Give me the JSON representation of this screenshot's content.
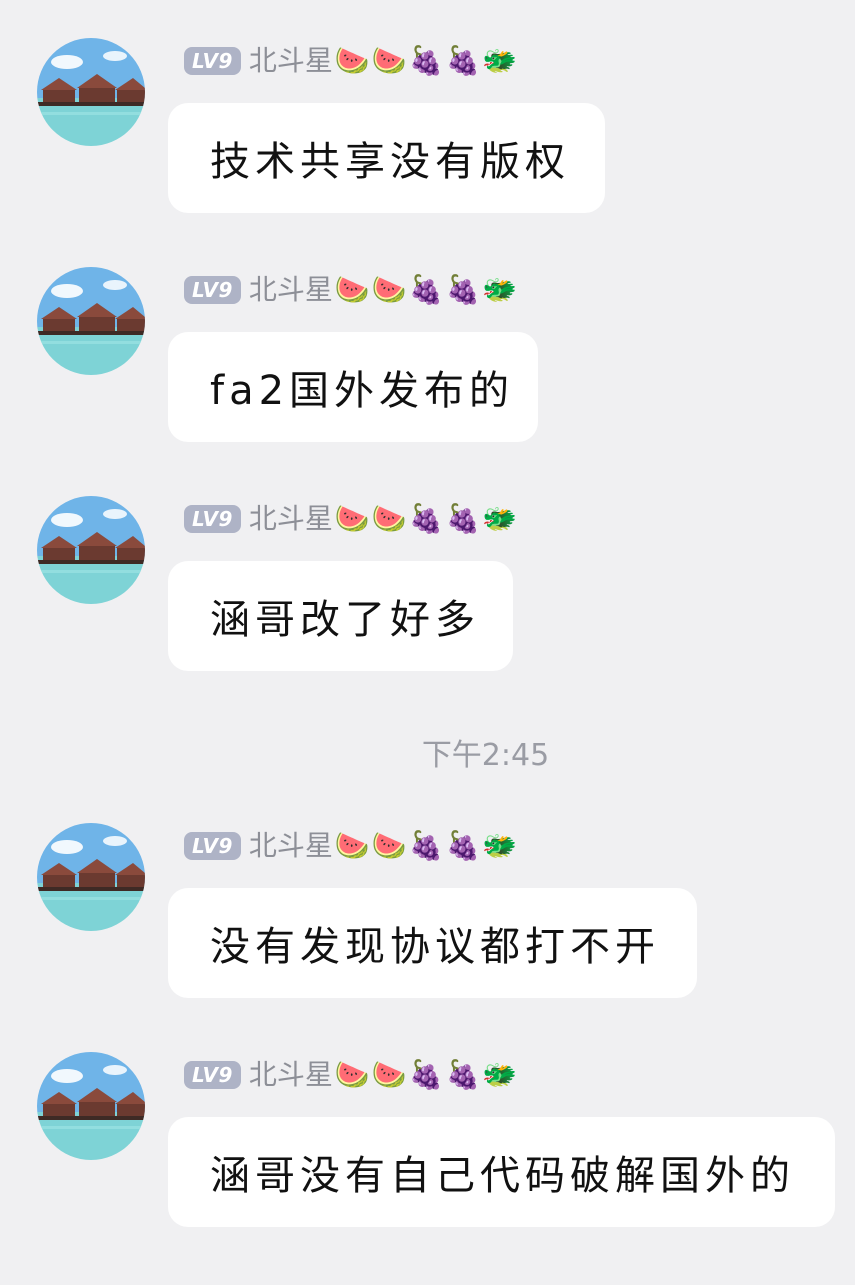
{
  "messages": [
    {
      "level": "LV9",
      "username": "北斗星",
      "emojis": [
        "🍉",
        "🍉",
        "🍇",
        "🍇",
        "🐲"
      ],
      "text": "技术共享没有版权"
    },
    {
      "level": "LV9",
      "username": "北斗星",
      "emojis": [
        "🍉",
        "🍉",
        "🍇",
        "🍇",
        "🐲"
      ],
      "text": "fa2国外发布的"
    },
    {
      "level": "LV9",
      "username": "北斗星",
      "emojis": [
        "🍉",
        "🍉",
        "🍇",
        "🍇",
        "🐲"
      ],
      "text": "涵哥改了好多"
    },
    {
      "level": "LV9",
      "username": "北斗星",
      "emojis": [
        "🍉",
        "🍉",
        "🍇",
        "🍇",
        "🐲"
      ],
      "text": "没有发现协议都打不开"
    },
    {
      "level": "LV9",
      "username": "北斗星",
      "emojis": [
        "🍉",
        "🍉",
        "🍇",
        "🍇",
        "🐲"
      ],
      "text": "涵哥没有自己代码破解国外的"
    }
  ],
  "timestamp": "下午2:45",
  "colors": {
    "background": "#f0f0f2",
    "bubble": "#ffffff",
    "level_badge": "#aeb3c6",
    "username": "#8d8f97",
    "message_text": "#111111",
    "timestamp": "#9a9ca4"
  }
}
